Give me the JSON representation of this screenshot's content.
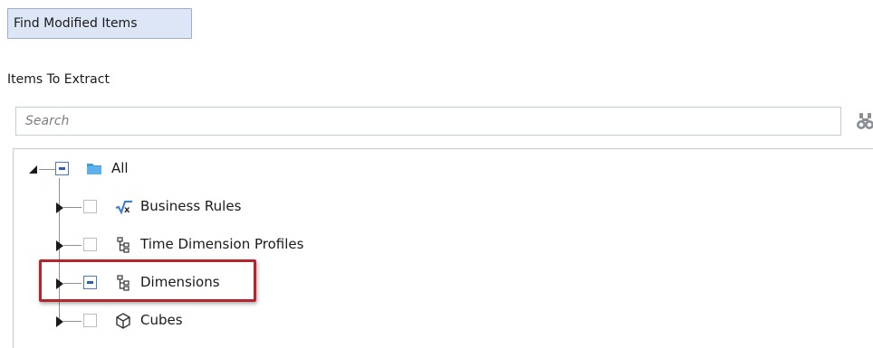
{
  "toolbar": {
    "find_modified_label": "Find Modified Items"
  },
  "section_label": "Items To Extract",
  "search": {
    "placeholder": "Search"
  },
  "tree": {
    "root": {
      "label": "All",
      "state": "partial",
      "expanded": true,
      "icon": "folder-icon"
    },
    "children": [
      {
        "label": "Business Rules",
        "state": "unchecked",
        "expanded": false,
        "icon": "formula-icon"
      },
      {
        "label": "Time Dimension Profiles",
        "state": "unchecked",
        "expanded": false,
        "icon": "hierarchy-icon"
      },
      {
        "label": "Dimensions",
        "state": "partial",
        "expanded": false,
        "icon": "hierarchy-icon",
        "highlighted": true
      },
      {
        "label": "Cubes",
        "state": "unchecked",
        "expanded": false,
        "icon": "cube-icon"
      }
    ]
  },
  "colors": {
    "button_bg": "#dde6f7",
    "checkbox_partial": "#2c5fb0",
    "folder": "#3f9be0",
    "highlight_border": "#b3262e"
  }
}
